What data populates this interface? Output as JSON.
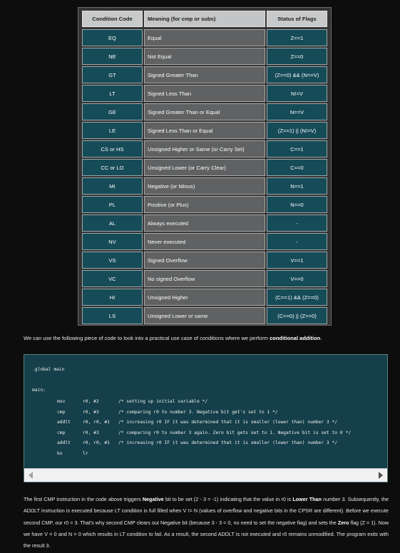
{
  "table": {
    "headers": [
      "Condition Code",
      "Meaning (for cmp or subs)",
      "Status of Flags"
    ],
    "rows": [
      [
        "EQ",
        "Equal",
        "Z==1"
      ],
      [
        "NE",
        "Not Equal",
        "Z==0"
      ],
      [
        "GT",
        "Signed Greater Than",
        "(Z==0) && (N==V)"
      ],
      [
        "LT",
        "Signed Less Than",
        "N!=V"
      ],
      [
        "GE",
        "Signed Greater Than or Equal",
        "N==V"
      ],
      [
        "LE",
        "Signed Less Than or Equal",
        "(Z==1) || (N!=V)"
      ],
      [
        "CS or HS",
        "Unsigned Higher or Same (or Carry Set)",
        "C==1"
      ],
      [
        "CC or LO",
        "Unsigned Lower (or Carry Clear)",
        "C==0"
      ],
      [
        "MI",
        "Negative (or Minus)",
        "N==1"
      ],
      [
        "PL",
        "Positive (or Plus)",
        "N==0"
      ],
      [
        "AL",
        "Always executed",
        "-"
      ],
      [
        "NV",
        "Never executed",
        "-"
      ],
      [
        "VS",
        "Signed Overflow",
        "V==1"
      ],
      [
        "VC",
        "No signed Overflow",
        "V==0"
      ],
      [
        "HI",
        "Unsigned Higher",
        "(C==1) && (Z==0)"
      ],
      [
        "LS",
        "Unsigned Lower or same",
        "(C==0) || (Z==0)"
      ]
    ]
  },
  "intro": {
    "text": "We can use the following piece of code to look into a practical use case of conditions where we perform ",
    "bold": "conditional addition",
    "end": "."
  },
  "code": {
    "directive": ".global main",
    "label": "main:",
    "lines": [
      [
        "mov",
        "r0, #2",
        "/* setting up initial variable */"
      ],
      [
        "cmp",
        "r0, #3",
        "/* comparing r0 to number 3. Negative bit get's set to 1 */"
      ],
      [
        "addlt",
        "r0, r0, #1",
        "/* increasing r0 IF it was determined that it is smaller (lower than) number 3 */"
      ],
      [
        "cmp",
        "r0, #3",
        "/* comparing r0 to number 3 again. Zero bit gets set to 1. Negative bit is set to 0 */"
      ],
      [
        "addlt",
        "r0, r0, #1",
        "/* increasing r0 IF it was determined that it is smaller (lower than) number 3 */"
      ],
      [
        "bx",
        "lr",
        ""
      ]
    ]
  },
  "paragraph": {
    "t1": "The first CMP instruction in the code above triggers ",
    "b1": "Negative",
    "t2": " bit to be set (2 - 3 = -1) indicating that the value in r0 is ",
    "b2": "Lower Than",
    "t3": " number 3. Subsequently, the ADDLT instruction is executed because LT condition is full filled when V != N (values of overflow and negative bits in the CPSR are different). Before we execute second CMP, our r0 = 3. That's why second CMP clears out Negative bit (because 3 - 3 = 0, no need to set the negative flag) and sets the ",
    "b3": "Zero",
    "t4": " flag (Z = 1). Now we have V = 0 and N = 0 which results in LT condition to fail. As a result, the second ADDLT is not executed and r0 remains unmodified. The program exits with the result 3."
  },
  "icons": {
    "scroll_left": "triangle-left-icon",
    "scroll_right": "triangle-right-icon"
  }
}
